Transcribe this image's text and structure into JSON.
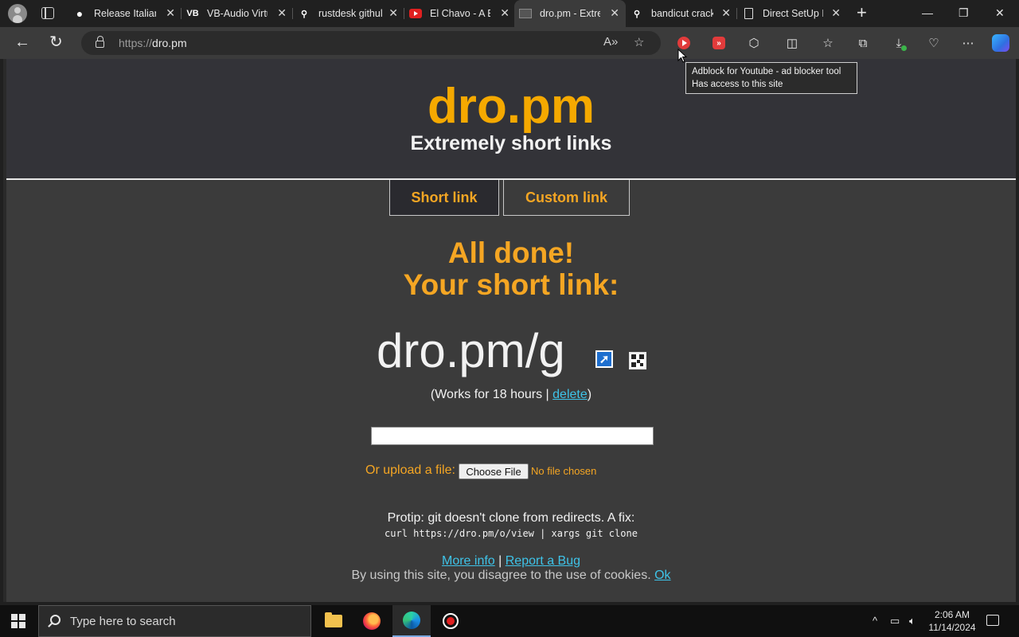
{
  "browser": {
    "tabs": [
      {
        "title": "Release Italian",
        "icon": "github-icon"
      },
      {
        "title": "VB-Audio Virtu",
        "icon": "vb-audio-icon"
      },
      {
        "title": "rustdesk githul",
        "icon": "search-icon"
      },
      {
        "title": "El Chavo - A Bi",
        "icon": "youtube-icon"
      },
      {
        "title": "dro.pm - Extre",
        "icon": "dro-pm-icon",
        "active": true
      },
      {
        "title": "bandicut crack",
        "icon": "search-icon"
      },
      {
        "title": "Direct SetUp F",
        "icon": "document-icon"
      }
    ],
    "url_scheme": "https://",
    "url_host": "dro.pm",
    "tooltip_line1": "Adblock for Youtube - ad blocker tool",
    "tooltip_line2": "Has access to this site"
  },
  "page": {
    "logo": "dro.pm",
    "tagline": "Extremely short links",
    "tab_short": "Short link",
    "tab_custom": "Custom link",
    "done_line1": "All done!",
    "done_line2": "Your short link:",
    "short_link": "dro.pm/g",
    "works_prefix": "(Works for 18 hours | ",
    "delete_label": "delete",
    "works_suffix": ")",
    "upload_label": "Or upload a file:",
    "choose_file": "Choose File",
    "no_file": "No file chosen",
    "protip": "Protip: git doesn't clone from redirects. A fix:",
    "protip_cmd": "curl https://dro.pm/o/view | xargs git clone",
    "more_info": "More info",
    "links_sep": " | ",
    "report_bug": "Report a Bug",
    "cookie_text": "By using this site, you disagree to the use of cookies. ",
    "cookie_ok": "Ok"
  },
  "taskbar": {
    "search_placeholder": "Type here to search",
    "time": "2:06 AM",
    "date": "11/14/2024"
  },
  "colors": {
    "accent_orange": "#f5a623",
    "logo_orange": "#f5a900",
    "link_blue": "#3ec3e8"
  }
}
